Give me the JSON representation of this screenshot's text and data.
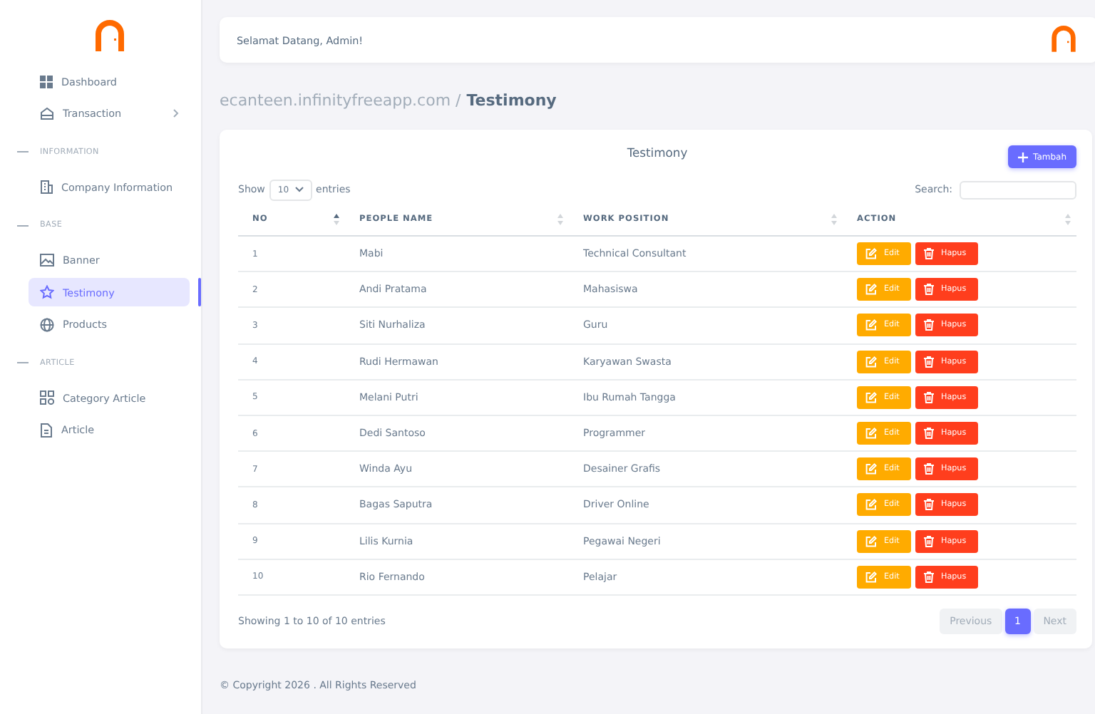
{
  "sidebar": {
    "items": [
      {
        "kind": "item",
        "label": "Dashboard",
        "selected": false,
        "has_submenu": false
      },
      {
        "kind": "item",
        "label": "Transaction",
        "selected": false,
        "has_submenu": true
      },
      {
        "kind": "section",
        "label": "INFORMATION"
      },
      {
        "kind": "item",
        "label": "Company Information",
        "selected": false,
        "has_submenu": false
      },
      {
        "kind": "section",
        "label": "BASE"
      },
      {
        "kind": "item",
        "label": "Banner",
        "selected": false,
        "has_submenu": false
      },
      {
        "kind": "item",
        "label": "Testimony",
        "selected": true,
        "has_submenu": false
      },
      {
        "kind": "item",
        "label": "Products",
        "selected": false,
        "has_submenu": false
      },
      {
        "kind": "section",
        "label": "ARTICLE"
      },
      {
        "kind": "item",
        "label": "Category Article",
        "selected": false,
        "has_submenu": false
      },
      {
        "kind": "item",
        "label": "Article",
        "selected": false,
        "has_submenu": false
      }
    ]
  },
  "header": {
    "greeting": "Selamat Datang, Admin!"
  },
  "breadcrumb": {
    "site": "ecanteen.infinityfreeapp.com /",
    "page": "Testimony"
  },
  "card": {
    "title": "Testimony",
    "add_button": "Tambah",
    "show_label": "Show",
    "page_size": "10",
    "entries_label": "entries",
    "search_label": "Search:",
    "table": {
      "columns": [
        {
          "label": "NO",
          "sorted_ascending": true
        },
        {
          "label": "PEOPLE NAME",
          "sorted_ascending": false
        },
        {
          "label": "WORK POSITION",
          "sorted_ascending": false
        },
        {
          "label": "ACTION",
          "sorted_ascending": false
        }
      ],
      "rows": [
        {
          "no": "1",
          "name": "Mabi",
          "position": "Technical Consultant",
          "actions": [
            "Edit",
            "Hapus"
          ]
        },
        {
          "no": "2",
          "name": "Andi Pratama",
          "position": "Mahasiswa",
          "actions": [
            "Edit",
            "Hapus"
          ]
        },
        {
          "no": "3",
          "name": "Siti Nurhaliza",
          "position": "Guru",
          "actions": [
            "Edit",
            "Hapus"
          ]
        },
        {
          "no": "4",
          "name": "Rudi Hermawan",
          "position": "Karyawan Swasta",
          "actions": [
            "Edit",
            "Hapus"
          ]
        },
        {
          "no": "5",
          "name": "Melani Putri",
          "position": "Ibu Rumah Tangga",
          "actions": [
            "Edit",
            "Hapus"
          ]
        },
        {
          "no": "6",
          "name": "Dedi Santoso",
          "position": "Programmer",
          "actions": [
            "Edit",
            "Hapus"
          ]
        },
        {
          "no": "7",
          "name": "Winda Ayu",
          "position": "Desainer Grafis",
          "actions": [
            "Edit",
            "Hapus"
          ]
        },
        {
          "no": "8",
          "name": "Bagas Saputra",
          "position": "Driver Online",
          "actions": [
            "Edit",
            "Hapus"
          ]
        },
        {
          "no": "9",
          "name": "Lilis Kurnia",
          "position": "Pegawai Negeri",
          "actions": [
            "Edit",
            "Hapus"
          ]
        },
        {
          "no": "10",
          "name": "Rio Fernando",
          "position": "Pelajar",
          "actions": [
            "Edit",
            "Hapus"
          ]
        }
      ]
    },
    "info": "Showing 1 to 10 of 10 entries",
    "pagination": {
      "previous": {
        "label": "Previous",
        "disabled": true
      },
      "pages": [
        {
          "label": "1",
          "selected": true
        }
      ],
      "next": {
        "label": "Next",
        "disabled": true
      }
    }
  },
  "footer": "© Copyright 2026 . All Rights Reserved"
}
